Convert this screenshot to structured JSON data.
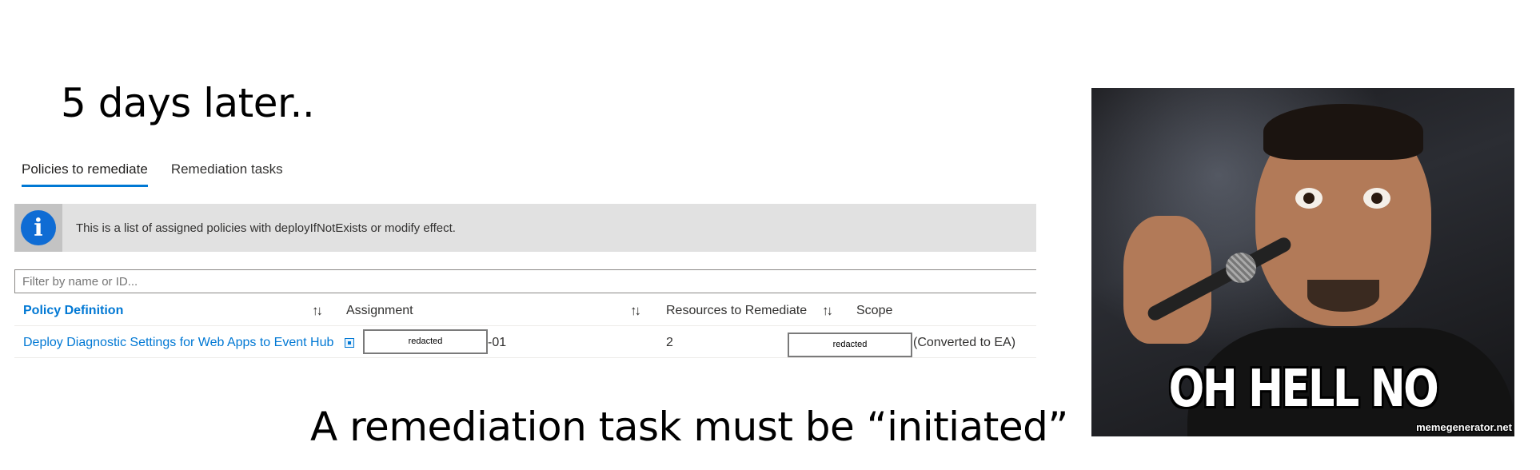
{
  "slide": {
    "title": "5 days later..",
    "bottom_text": "A remediation task must be “initiated”"
  },
  "tabs": [
    {
      "label": "Policies to remediate",
      "active": true
    },
    {
      "label": "Remediation tasks",
      "active": false
    }
  ],
  "info_bar": {
    "icon": "info-icon",
    "icon_glyph": "i",
    "text": "This is a list of assigned policies with deployIfNotExists or modify effect."
  },
  "filter": {
    "placeholder": "Filter by name or ID..."
  },
  "grid": {
    "sort_glyph": "↑↓",
    "columns": {
      "policy_definition": "Policy Definition",
      "assignment": "Assignment",
      "resources": "Resources to Remediate",
      "scope": "Scope"
    },
    "rows": [
      {
        "policy_definition": "Deploy Diagnostic Settings for Web Apps to Event Hub",
        "assignment_redacted": "redacted",
        "assignment_suffix": "-01",
        "resources": "2",
        "scope_redacted": "redacted",
        "scope_suffix": "(Converted to EA)"
      }
    ]
  },
  "meme": {
    "caption": "OH HELL NO",
    "watermark": "memegenerator.net"
  },
  "colors": {
    "accent": "#0078d4",
    "info_bar_bg": "#e1e1e1",
    "info_icon": "#0f6cd4"
  }
}
